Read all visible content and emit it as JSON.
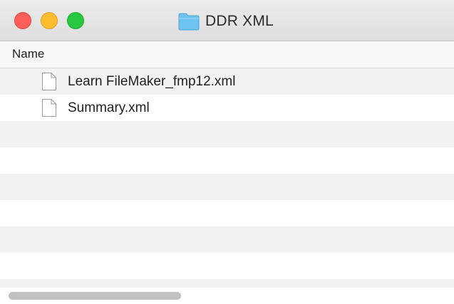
{
  "window": {
    "title": "DDR XML",
    "title_icon": "folder-icon",
    "controls": [
      "close",
      "minimize",
      "zoom"
    ]
  },
  "columns": {
    "name": "Name"
  },
  "files": [
    {
      "name": "Learn FileMaker_fmp12.xml",
      "icon": "document-icon"
    },
    {
      "name": "Summary.xml",
      "icon": "document-icon"
    }
  ],
  "colors": {
    "close": "#fc5f57",
    "minimize": "#fdbc2e",
    "zoom": "#28c840",
    "folder": "#6fc3f0",
    "row_stripe": "#f2f2f2"
  }
}
